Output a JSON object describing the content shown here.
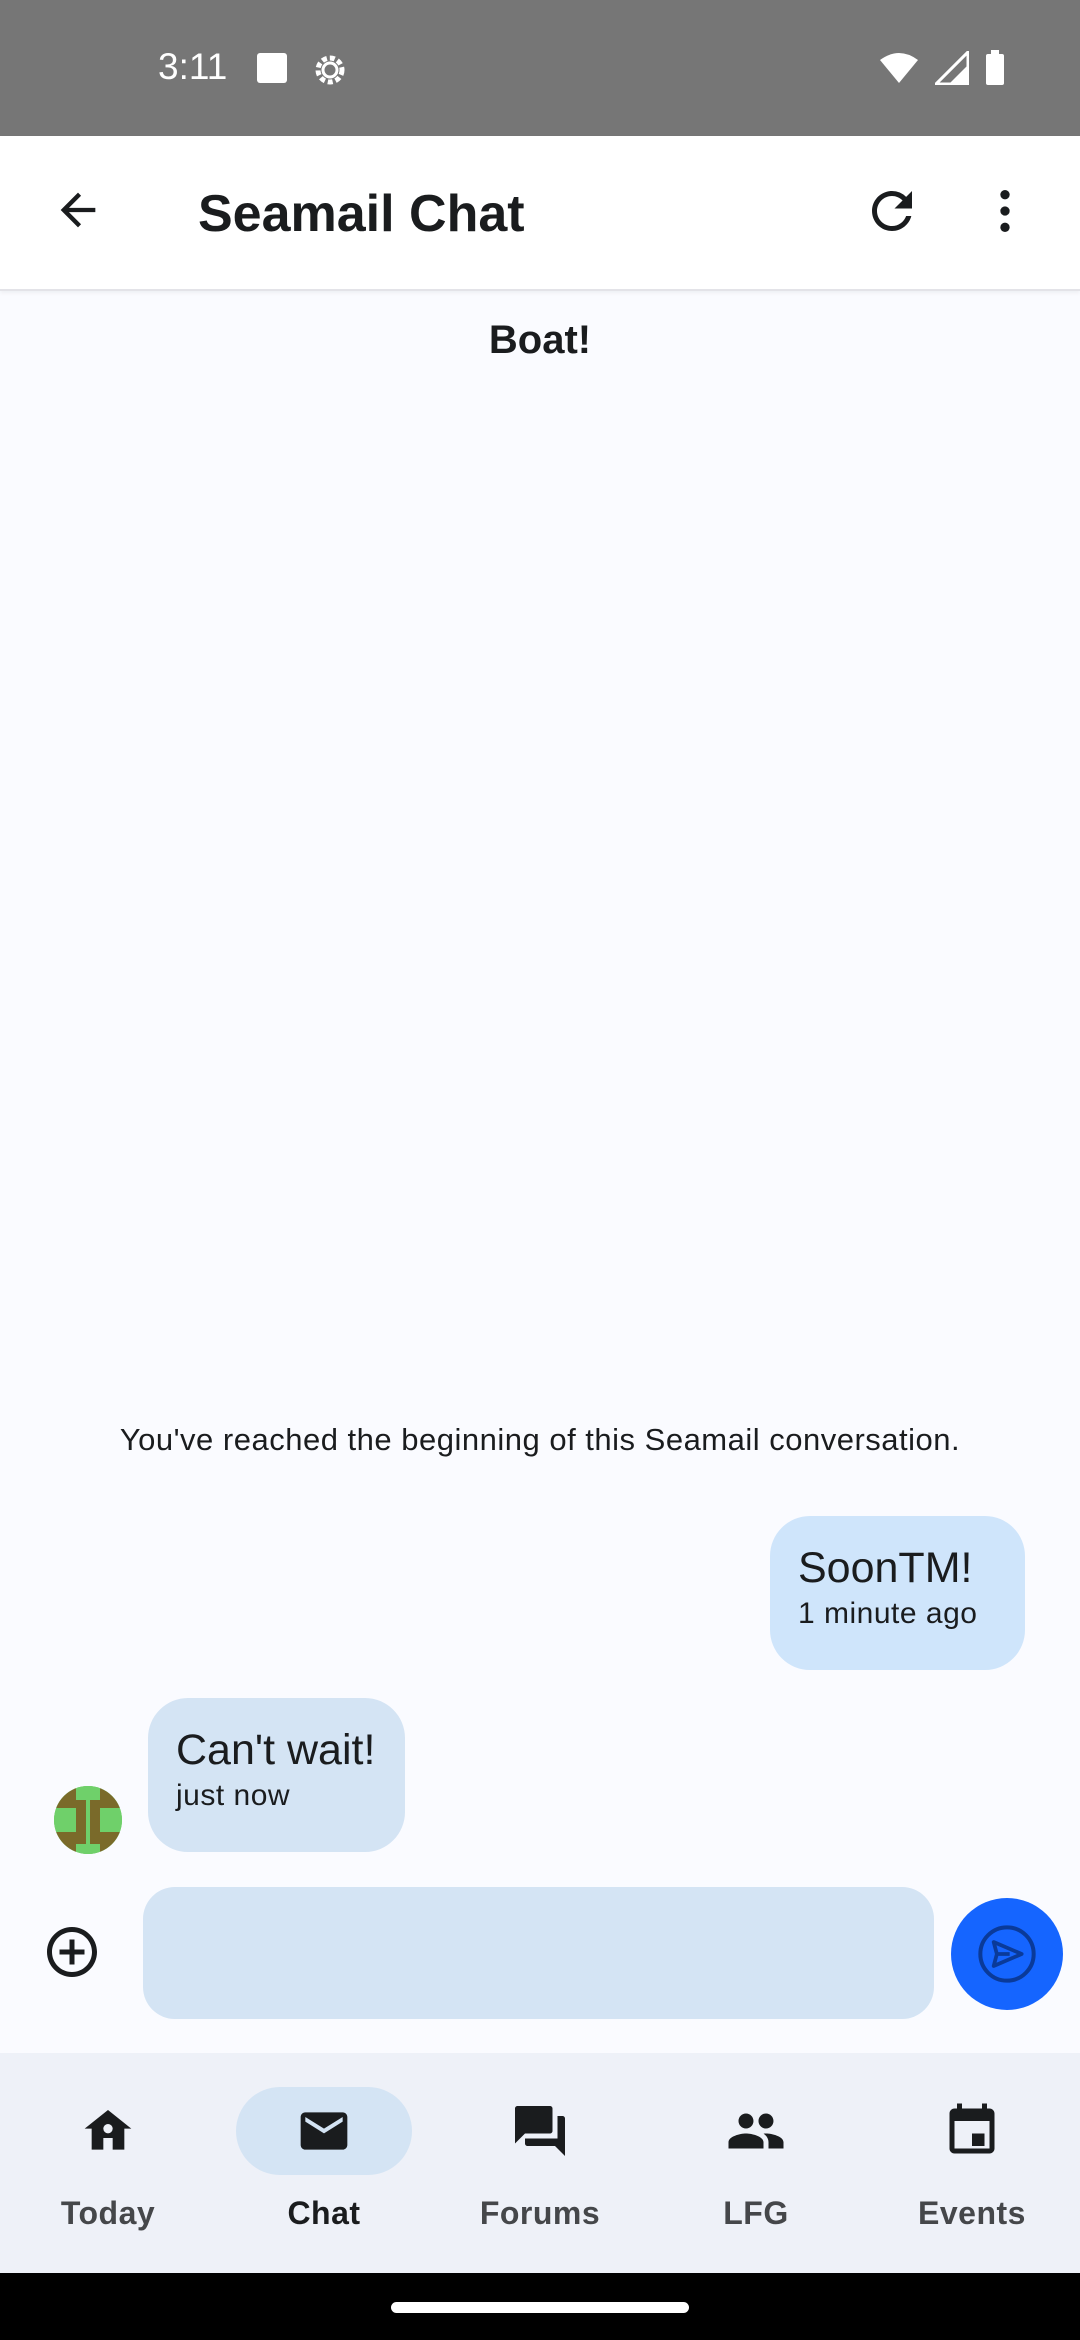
{
  "status_bar": {
    "time": "3:11",
    "icons": [
      "square-notification-icon",
      "gear-icon",
      "wifi-icon",
      "signal-icon",
      "battery-icon"
    ]
  },
  "app_bar": {
    "title": "Seamail Chat",
    "icons": [
      "back-arrow-icon",
      "refresh-icon",
      "more-vertical-icon"
    ]
  },
  "conversation": {
    "title": "Boat!",
    "beginning_notice": "You've reached the beginning of this Seamail conversation.",
    "messages": [
      {
        "direction": "outgoing",
        "text": "SoonTM!",
        "time": "1 minute ago"
      },
      {
        "direction": "incoming",
        "text": "Can't wait!",
        "time": "just now",
        "avatar": "identicon-avatar"
      }
    ]
  },
  "composer": {
    "placeholder": "",
    "value": "",
    "icons": [
      "add-circle-icon",
      "send-icon"
    ]
  },
  "bottom_nav": {
    "items": [
      {
        "label": "Today",
        "icon": "home-icon",
        "active": false
      },
      {
        "label": "Chat",
        "icon": "mail-icon",
        "active": true
      },
      {
        "label": "Forums",
        "icon": "forum-icon",
        "active": false
      },
      {
        "label": "LFG",
        "icon": "group-icon",
        "active": false
      },
      {
        "label": "Events",
        "icon": "calendar-icon",
        "active": false
      }
    ]
  },
  "colors": {
    "accent": "#1565ff",
    "bubble": "#d4e4f4",
    "status_bar": "#767676"
  }
}
